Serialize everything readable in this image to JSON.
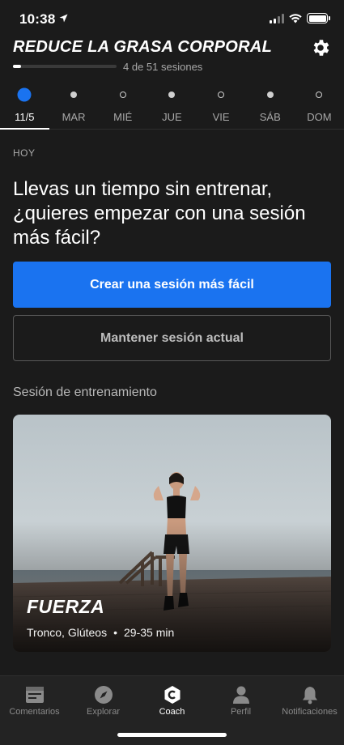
{
  "status": {
    "time": "10:38"
  },
  "header": {
    "title": "REDUCE LA GRASA CORPORAL",
    "progress_text": "4 de 51 sesiones",
    "progress_fraction": 0.078
  },
  "days": [
    {
      "label": "11/5",
      "selected": true,
      "dot": "large-blue"
    },
    {
      "label": "MAR",
      "dot": "small-gray"
    },
    {
      "label": "MIÉ",
      "dot": "small-ring"
    },
    {
      "label": "JUE",
      "dot": "small-gray"
    },
    {
      "label": "VIE",
      "dot": "small-ring"
    },
    {
      "label": "SÁB",
      "dot": "small-gray"
    },
    {
      "label": "DOM",
      "dot": "small-ring"
    }
  ],
  "main": {
    "today_label": "HOY",
    "prompt": "Llevas un tiempo sin entrenar, ¿quieres empezar con una sesión más fácil?",
    "primary_button": "Crear una sesión más fácil",
    "secondary_button": "Mantener sesión actual",
    "section_title": "Sesión de entrenamiento",
    "workout": {
      "name": "FUERZA",
      "focus": "Tronco, Glúteos",
      "separator": "•",
      "duration": "29-35 min"
    }
  },
  "tabs": [
    {
      "label": "Comentarios",
      "icon": "feed-icon"
    },
    {
      "label": "Explorar",
      "icon": "compass-icon"
    },
    {
      "label": "Coach",
      "icon": "coach-icon",
      "active": true
    },
    {
      "label": "Perfil",
      "icon": "person-icon"
    },
    {
      "label": "Notificaciones",
      "icon": "bell-icon"
    }
  ],
  "colors": {
    "accent": "#1a73f0",
    "background": "#1b1b1b"
  }
}
